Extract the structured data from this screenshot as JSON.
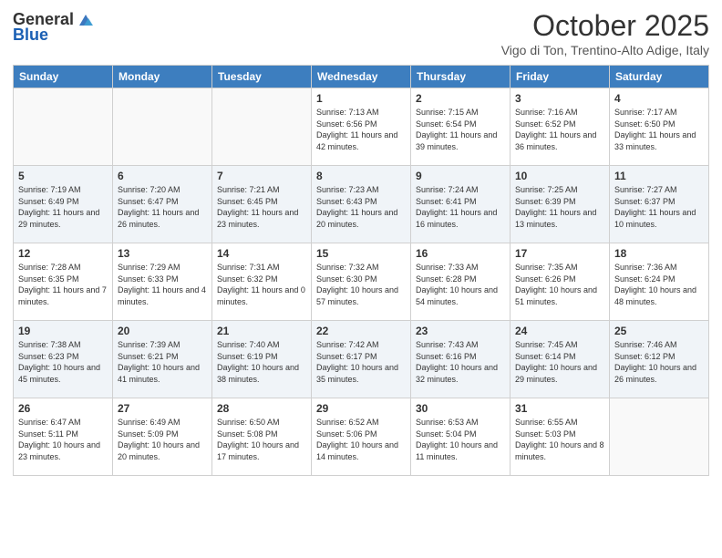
{
  "header": {
    "logo_general": "General",
    "logo_blue": "Blue",
    "month_title": "October 2025",
    "subtitle": "Vigo di Ton, Trentino-Alto Adige, Italy"
  },
  "days_of_week": [
    "Sunday",
    "Monday",
    "Tuesday",
    "Wednesday",
    "Thursday",
    "Friday",
    "Saturday"
  ],
  "weeks": [
    [
      {
        "day": "",
        "info": ""
      },
      {
        "day": "",
        "info": ""
      },
      {
        "day": "",
        "info": ""
      },
      {
        "day": "1",
        "info": "Sunrise: 7:13 AM\nSunset: 6:56 PM\nDaylight: 11 hours and 42 minutes."
      },
      {
        "day": "2",
        "info": "Sunrise: 7:15 AM\nSunset: 6:54 PM\nDaylight: 11 hours and 39 minutes."
      },
      {
        "day": "3",
        "info": "Sunrise: 7:16 AM\nSunset: 6:52 PM\nDaylight: 11 hours and 36 minutes."
      },
      {
        "day": "4",
        "info": "Sunrise: 7:17 AM\nSunset: 6:50 PM\nDaylight: 11 hours and 33 minutes."
      }
    ],
    [
      {
        "day": "5",
        "info": "Sunrise: 7:19 AM\nSunset: 6:49 PM\nDaylight: 11 hours and 29 minutes."
      },
      {
        "day": "6",
        "info": "Sunrise: 7:20 AM\nSunset: 6:47 PM\nDaylight: 11 hours and 26 minutes."
      },
      {
        "day": "7",
        "info": "Sunrise: 7:21 AM\nSunset: 6:45 PM\nDaylight: 11 hours and 23 minutes."
      },
      {
        "day": "8",
        "info": "Sunrise: 7:23 AM\nSunset: 6:43 PM\nDaylight: 11 hours and 20 minutes."
      },
      {
        "day": "9",
        "info": "Sunrise: 7:24 AM\nSunset: 6:41 PM\nDaylight: 11 hours and 16 minutes."
      },
      {
        "day": "10",
        "info": "Sunrise: 7:25 AM\nSunset: 6:39 PM\nDaylight: 11 hours and 13 minutes."
      },
      {
        "day": "11",
        "info": "Sunrise: 7:27 AM\nSunset: 6:37 PM\nDaylight: 11 hours and 10 minutes."
      }
    ],
    [
      {
        "day": "12",
        "info": "Sunrise: 7:28 AM\nSunset: 6:35 PM\nDaylight: 11 hours and 7 minutes."
      },
      {
        "day": "13",
        "info": "Sunrise: 7:29 AM\nSunset: 6:33 PM\nDaylight: 11 hours and 4 minutes."
      },
      {
        "day": "14",
        "info": "Sunrise: 7:31 AM\nSunset: 6:32 PM\nDaylight: 11 hours and 0 minutes."
      },
      {
        "day": "15",
        "info": "Sunrise: 7:32 AM\nSunset: 6:30 PM\nDaylight: 10 hours and 57 minutes."
      },
      {
        "day": "16",
        "info": "Sunrise: 7:33 AM\nSunset: 6:28 PM\nDaylight: 10 hours and 54 minutes."
      },
      {
        "day": "17",
        "info": "Sunrise: 7:35 AM\nSunset: 6:26 PM\nDaylight: 10 hours and 51 minutes."
      },
      {
        "day": "18",
        "info": "Sunrise: 7:36 AM\nSunset: 6:24 PM\nDaylight: 10 hours and 48 minutes."
      }
    ],
    [
      {
        "day": "19",
        "info": "Sunrise: 7:38 AM\nSunset: 6:23 PM\nDaylight: 10 hours and 45 minutes."
      },
      {
        "day": "20",
        "info": "Sunrise: 7:39 AM\nSunset: 6:21 PM\nDaylight: 10 hours and 41 minutes."
      },
      {
        "day": "21",
        "info": "Sunrise: 7:40 AM\nSunset: 6:19 PM\nDaylight: 10 hours and 38 minutes."
      },
      {
        "day": "22",
        "info": "Sunrise: 7:42 AM\nSunset: 6:17 PM\nDaylight: 10 hours and 35 minutes."
      },
      {
        "day": "23",
        "info": "Sunrise: 7:43 AM\nSunset: 6:16 PM\nDaylight: 10 hours and 32 minutes."
      },
      {
        "day": "24",
        "info": "Sunrise: 7:45 AM\nSunset: 6:14 PM\nDaylight: 10 hours and 29 minutes."
      },
      {
        "day": "25",
        "info": "Sunrise: 7:46 AM\nSunset: 6:12 PM\nDaylight: 10 hours and 26 minutes."
      }
    ],
    [
      {
        "day": "26",
        "info": "Sunrise: 6:47 AM\nSunset: 5:11 PM\nDaylight: 10 hours and 23 minutes."
      },
      {
        "day": "27",
        "info": "Sunrise: 6:49 AM\nSunset: 5:09 PM\nDaylight: 10 hours and 20 minutes."
      },
      {
        "day": "28",
        "info": "Sunrise: 6:50 AM\nSunset: 5:08 PM\nDaylight: 10 hours and 17 minutes."
      },
      {
        "day": "29",
        "info": "Sunrise: 6:52 AM\nSunset: 5:06 PM\nDaylight: 10 hours and 14 minutes."
      },
      {
        "day": "30",
        "info": "Sunrise: 6:53 AM\nSunset: 5:04 PM\nDaylight: 10 hours and 11 minutes."
      },
      {
        "day": "31",
        "info": "Sunrise: 6:55 AM\nSunset: 5:03 PM\nDaylight: 10 hours and 8 minutes."
      },
      {
        "day": "",
        "info": ""
      }
    ]
  ]
}
